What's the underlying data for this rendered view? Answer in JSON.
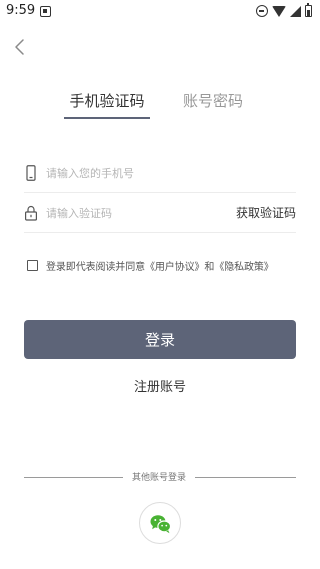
{
  "status_bar": {
    "time": "9:59",
    "icons": [
      "notification-icon",
      "do-not-disturb-icon",
      "wifi-icon",
      "signal-icon",
      "battery-icon"
    ]
  },
  "nav": {
    "back_icon": "chevron-left-icon"
  },
  "tabs": [
    {
      "label": "手机验证码",
      "active": true
    },
    {
      "label": "账号密码",
      "active": false
    }
  ],
  "phone_field": {
    "icon": "phone-icon",
    "placeholder": "请输入您的手机号",
    "value": ""
  },
  "code_field": {
    "icon": "lock-icon",
    "placeholder": "请输入验证码",
    "value": "",
    "get_code_label": "获取验证码"
  },
  "agreement": {
    "checked": false,
    "prefix": "登录即代表阅读并同意",
    "user_agreement": "《用户协议》",
    "conjunction": "和",
    "privacy_policy": "《隐私政策》"
  },
  "login_button": {
    "label": "登录"
  },
  "register_link": {
    "label": "注册账号"
  },
  "other_login": {
    "label": "其他账号登录",
    "icon": "wechat-icon"
  },
  "colors": {
    "primary": "#5d6478",
    "text": "#333333",
    "placeholder": "#b5b5b5",
    "inactive_tab": "#999999",
    "wechat_green": "#49b233"
  }
}
